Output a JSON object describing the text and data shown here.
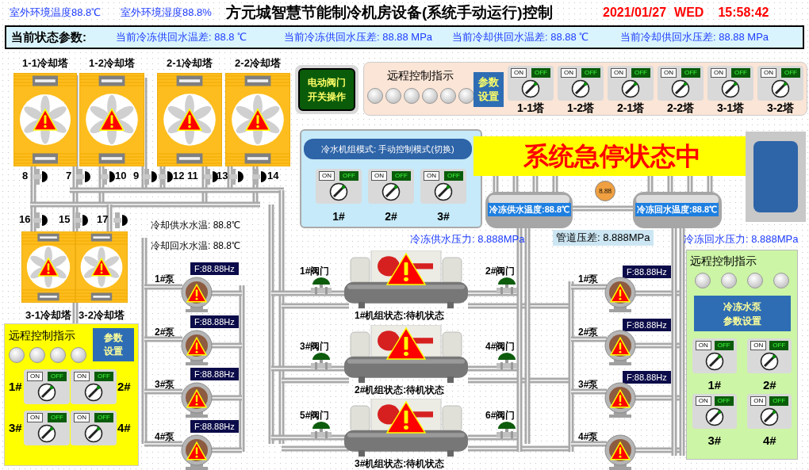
{
  "header": {
    "outdoor_temperature": "室外环境温度88.8℃",
    "outdoor_humidity": "室外环境湿度88.8%",
    "title": "方元城智慧节能制冷机房设备(系统手动运行)控制",
    "date": "2021/01/27",
    "weekday": "WED",
    "time": "15:58:42"
  },
  "status_bar": {
    "label": "当前状态参数:",
    "items": [
      "当前冷冻供回水温差: 88.8 ℃",
      "当前冷冻供回水压差: 88.88 MPa",
      "当前冷却供回水温差: 88.88 ℃",
      "当前冷却供回水压差: 88.88 MPa"
    ]
  },
  "cooling_towers": [
    {
      "label": "1-1冷却塔",
      "alarm": true
    },
    {
      "label": "1-2冷却塔",
      "alarm": true
    },
    {
      "label": "2-1冷却塔",
      "alarm": true
    },
    {
      "label": "2-2冷却塔",
      "alarm": true
    },
    {
      "label": "3-1冷却塔",
      "alarm": true
    },
    {
      "label": "3-2冷却塔",
      "alarm": true
    }
  ],
  "tower_valves": [
    "8",
    "7",
    "10",
    "9",
    "12",
    "11",
    "13",
    "14",
    "16",
    "15",
    "17"
  ],
  "cooling_water": [
    "冷却供水水温: 88.8℃",
    "冷却回水水温: 88.8℃"
  ],
  "valve_button": [
    "电动阀门",
    "开关操作"
  ],
  "tower_remote": {
    "title": "远程控制指示",
    "lamps": [
      {
        "on": false
      },
      {
        "on": false
      },
      {
        "on": false
      },
      {
        "on": false
      },
      {
        "on": false
      },
      {
        "on": false
      }
    ],
    "settings_button": [
      "参数",
      "设置"
    ],
    "switches": [
      {
        "label": "1-1塔",
        "on_text": "ON",
        "off_text": "OFF",
        "on": false
      },
      {
        "label": "1-2塔",
        "on_text": "ON",
        "off_text": "OFF",
        "on": false
      },
      {
        "label": "2-1塔",
        "on_text": "ON",
        "off_text": "OFF",
        "on": false
      },
      {
        "label": "2-2塔",
        "on_text": "ON",
        "off_text": "OFF",
        "on": false
      },
      {
        "label": "3-1塔",
        "on_text": "ON",
        "off_text": "OFF",
        "on": false
      },
      {
        "label": "3-2塔",
        "on_text": "ON",
        "off_text": "OFF",
        "on": false
      }
    ]
  },
  "chiller_mode": {
    "title": "冷水机组模式: 手动控制模式(切换)",
    "switches": [
      {
        "label": "1#",
        "on_text": "ON",
        "off_text": "OFF",
        "on": false
      },
      {
        "label": "2#",
        "on_text": "ON",
        "off_text": "OFF",
        "on": false
      },
      {
        "label": "3#",
        "on_text": "ON",
        "off_text": "OFF",
        "on": false
      }
    ]
  },
  "alarm_banner": "系统急停状态中",
  "headers": {
    "supply": "冷冻供水温度:88.8℃",
    "return": "冷冻回水温度:88.8℃",
    "gauge": "8.88",
    "supply_pressure": "冷冻供水压力: 8.888MPa",
    "differential_pressure": "管道压差: 8.888MPa",
    "return_pressure": "冷冻回水压力: 8.888MPa"
  },
  "chillers": [
    {
      "status": "1#机组状态:待机状态",
      "alarm": true
    },
    {
      "status": "2#机组状态:待机状态",
      "alarm": true
    },
    {
      "status": "3#机组状态:待机状态",
      "alarm": true
    }
  ],
  "chiller_valves": [
    "1#阀门",
    "2#阀门",
    "3#阀门",
    "4#阀门",
    "5#阀门",
    "6#阀门"
  ],
  "cooling_pumps": [
    {
      "label": "1#泵",
      "frequency": "F:88.88Hz",
      "alarm": true
    },
    {
      "label": "2#泵",
      "frequency": "F:88.88Hz",
      "alarm": true
    },
    {
      "label": "3#泵",
      "frequency": "F:88.88Hz",
      "alarm": true
    },
    {
      "label": "4#泵",
      "frequency": "F:88.88Hz",
      "alarm": true
    }
  ],
  "chilled_pumps": [
    {
      "label": "1#泵",
      "frequency": "F:88.88Hz",
      "alarm": true
    },
    {
      "label": "2#泵",
      "frequency": "F:88.88Hz",
      "alarm": true
    },
    {
      "label": "3#泵",
      "frequency": "F:88.88Hz",
      "alarm": true
    },
    {
      "label": "4#泵",
      "alarm": true
    }
  ],
  "cooling_tower_panel": {
    "title": "远程控制指示",
    "lamps": [
      {
        "on": false
      },
      {
        "on": false
      },
      {
        "on": false
      },
      {
        "on": false
      }
    ],
    "settings_button": [
      "参数",
      "设置"
    ],
    "switches": [
      {
        "label": "1#",
        "on_text": "ON",
        "off_text": "OFF",
        "on": false
      },
      {
        "label": "2#",
        "on_text": "ON",
        "off_text": "OFF",
        "on": false
      },
      {
        "label": "3#",
        "on_text": "ON",
        "off_text": "OFF",
        "on": false
      },
      {
        "label": "4#",
        "on_text": "ON",
        "off_text": "OFF",
        "on": false
      }
    ]
  },
  "chilled_pump_panel": {
    "title": "远程控制指示",
    "lamps": [
      {
        "on": false
      },
      {
        "on": false
      },
      {
        "on": false
      },
      {
        "on": false
      }
    ],
    "settings_button": [
      "冷冻水泵",
      "参数设置"
    ],
    "switches": [
      {
        "label": "1#",
        "on_text": "ON",
        "off_text": "OFF",
        "on": false
      },
      {
        "label": "2#",
        "on_text": "ON",
        "off_text": "OFF",
        "on": false
      },
      {
        "label": "3#",
        "on_text": "ON",
        "off_text": "OFF",
        "on": false
      },
      {
        "label": "4#",
        "on_text": "ON",
        "off_text": "OFF",
        "on": false
      }
    ]
  }
}
